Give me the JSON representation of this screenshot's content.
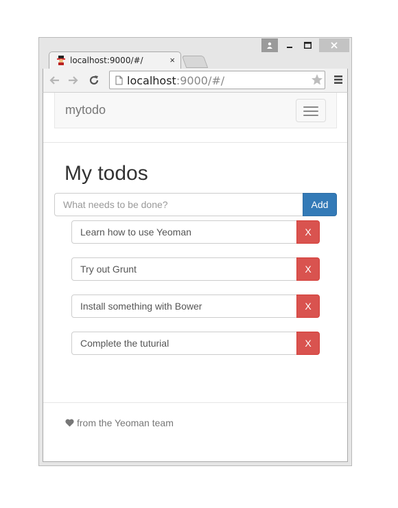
{
  "browser": {
    "tab_title": "localhost:9000/#/",
    "tab_close": "×",
    "url_host": "localhost",
    "url_rest": ":9000/#/"
  },
  "navbar": {
    "brand": "mytodo"
  },
  "main": {
    "title": "My todos",
    "add_placeholder": "What needs to be done?",
    "add_label": "Add",
    "todos": [
      {
        "text": "Learn how to use Yeoman",
        "delete_label": "X"
      },
      {
        "text": "Try out Grunt",
        "delete_label": "X"
      },
      {
        "text": "Install something with Bower",
        "delete_label": "X"
      },
      {
        "text": "Complete the tuturial",
        "delete_label": "X"
      }
    ]
  },
  "footer": {
    "text": "from the Yeoman team"
  },
  "colors": {
    "primary": "#337ab7",
    "danger": "#d9534f"
  },
  "icons": [
    "user-icon",
    "minimize-icon",
    "maximize-icon",
    "close-window-icon",
    "yeoman-favicon",
    "back-arrow-icon",
    "forward-arrow-icon",
    "reload-icon",
    "page-icon",
    "star-icon",
    "menu-icon",
    "heart-icon"
  ]
}
